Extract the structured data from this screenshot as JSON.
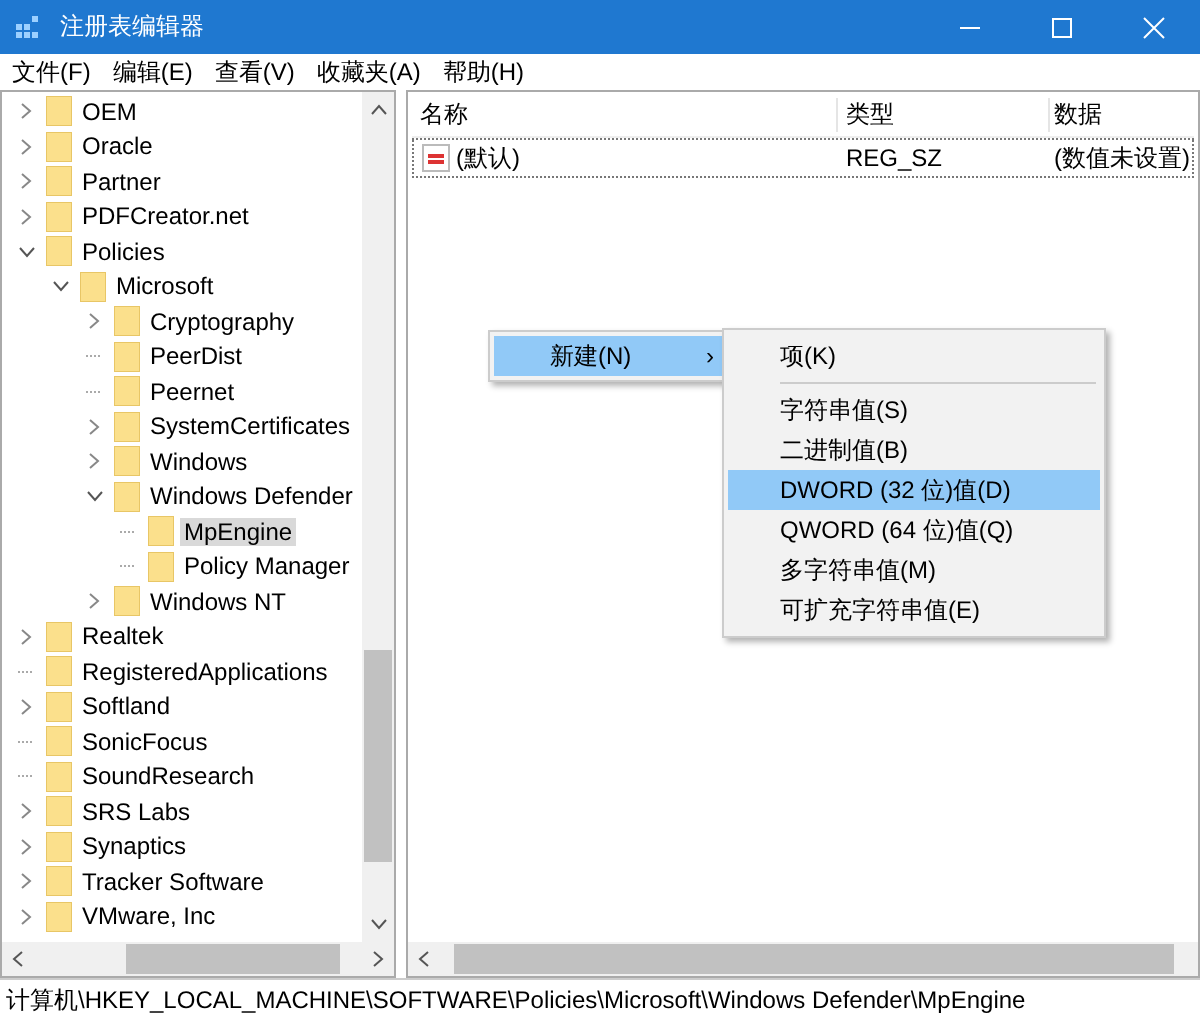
{
  "window": {
    "title": "注册表编辑器"
  },
  "menu": [
    "文件(F)",
    "编辑(E)",
    "查看(V)",
    "收藏夹(A)",
    "帮助(H)"
  ],
  "tree": [
    {
      "label": "OEM",
      "kind": "collapsed",
      "selected": false
    },
    {
      "label": "Oracle",
      "kind": "collapsed",
      "selected": false
    },
    {
      "label": "Partner",
      "kind": "collapsed",
      "selected": false
    },
    {
      "label": "PDFCreator.net",
      "kind": "collapsed",
      "selected": false
    },
    {
      "label": "Policies",
      "kind": "expanded",
      "selected": false,
      "children": [
        {
          "label": "Microsoft",
          "kind": "expanded",
          "selected": false,
          "children": [
            {
              "label": "Cryptography",
              "kind": "collapsed",
              "selected": false
            },
            {
              "label": "PeerDist",
              "kind": "leaf",
              "selected": false
            },
            {
              "label": "Peernet",
              "kind": "leaf",
              "selected": false
            },
            {
              "label": "SystemCertificates",
              "kind": "collapsed",
              "selected": false
            },
            {
              "label": "Windows",
              "kind": "collapsed",
              "selected": false
            },
            {
              "label": "Windows Defender",
              "kind": "expanded",
              "selected": false,
              "children": [
                {
                  "label": "MpEngine",
                  "kind": "leaf",
                  "selected": true
                },
                {
                  "label": "Policy Manager",
                  "kind": "leaf",
                  "selected": false
                }
              ]
            },
            {
              "label": "Windows NT",
              "kind": "collapsed",
              "selected": false
            }
          ]
        }
      ]
    },
    {
      "label": "Realtek",
      "kind": "collapsed",
      "selected": false
    },
    {
      "label": "RegisteredApplications",
      "kind": "leaf",
      "selected": false
    },
    {
      "label": "Softland",
      "kind": "collapsed",
      "selected": false
    },
    {
      "label": "SonicFocus",
      "kind": "leaf",
      "selected": false
    },
    {
      "label": "SoundResearch",
      "kind": "leaf",
      "selected": false
    },
    {
      "label": "SRS Labs",
      "kind": "collapsed",
      "selected": false
    },
    {
      "label": "Synaptics",
      "kind": "collapsed",
      "selected": false
    },
    {
      "label": "Tracker Software",
      "kind": "collapsed",
      "selected": false
    },
    {
      "label": "VMware, Inc",
      "kind": "collapsed",
      "selected": false
    }
  ],
  "table": {
    "columns": [
      "名称",
      "类型",
      "数据"
    ],
    "rows": [
      {
        "name": "(默认)",
        "type": "REG_SZ",
        "data": "(数值未设置)"
      }
    ]
  },
  "context_menu": {
    "items": [
      {
        "label": "新建(N)",
        "arrow": "›",
        "selected": true
      }
    ]
  },
  "submenu": {
    "items": [
      {
        "label": "项(K)",
        "kind": "item",
        "selected": false
      },
      {
        "kind": "separator"
      },
      {
        "label": "字符串值(S)",
        "kind": "item",
        "selected": false
      },
      {
        "label": "二进制值(B)",
        "kind": "item",
        "selected": false
      },
      {
        "label": "DWORD (32 位)值(D)",
        "kind": "item",
        "selected": true
      },
      {
        "label": "QWORD (64 位)值(Q)",
        "kind": "item",
        "selected": false
      },
      {
        "label": "多字符串值(M)",
        "kind": "item",
        "selected": false
      },
      {
        "label": "可扩充字符串值(E)",
        "kind": "item",
        "selected": false
      }
    ]
  },
  "status_bar": "计算机\\HKEY_LOCAL_MACHINE\\SOFTWARE\\Policies\\Microsoft\\Windows Defender\\MpEngine"
}
